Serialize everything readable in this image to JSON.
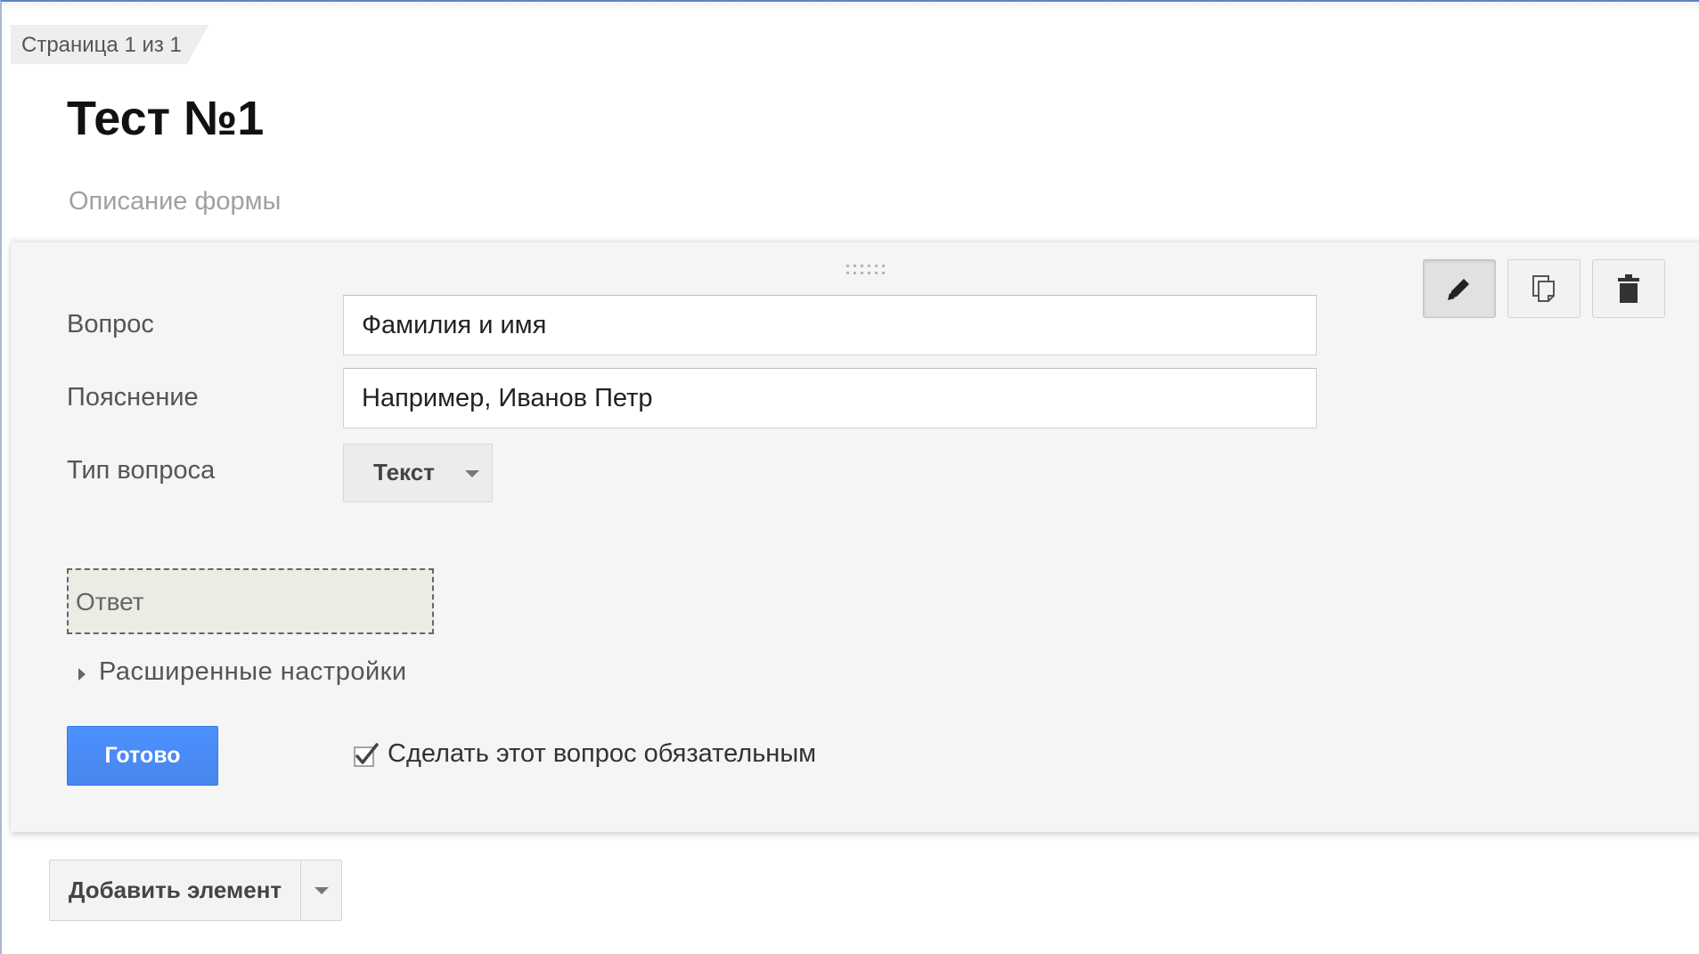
{
  "page_tab": {
    "label": "Страница 1 из 1"
  },
  "form": {
    "title": "Тест №1",
    "description_placeholder": "Описание формы"
  },
  "question_editor": {
    "toolbar": {
      "icons": [
        "pencil-icon",
        "copy-icon",
        "trash-icon"
      ]
    },
    "question_label": "Вопрос",
    "question_value": "Фамилия и имя",
    "help_label": "Пояснение",
    "help_value": "Например, Иванов Петр",
    "type_label": "Тип вопроса",
    "type_value": "Текст",
    "answer_preview": "Ответ",
    "advanced_settings": "Расширенные настройки",
    "done_button": "Готово",
    "required_checked": true,
    "required_label": "Сделать этот вопрос обязательным"
  },
  "add_item": {
    "label": "Добавить элемент"
  },
  "colors": {
    "primary_button": "#4d90fe",
    "card_background": "#f5f5f5",
    "answer_preview_background": "#ecebe4"
  }
}
